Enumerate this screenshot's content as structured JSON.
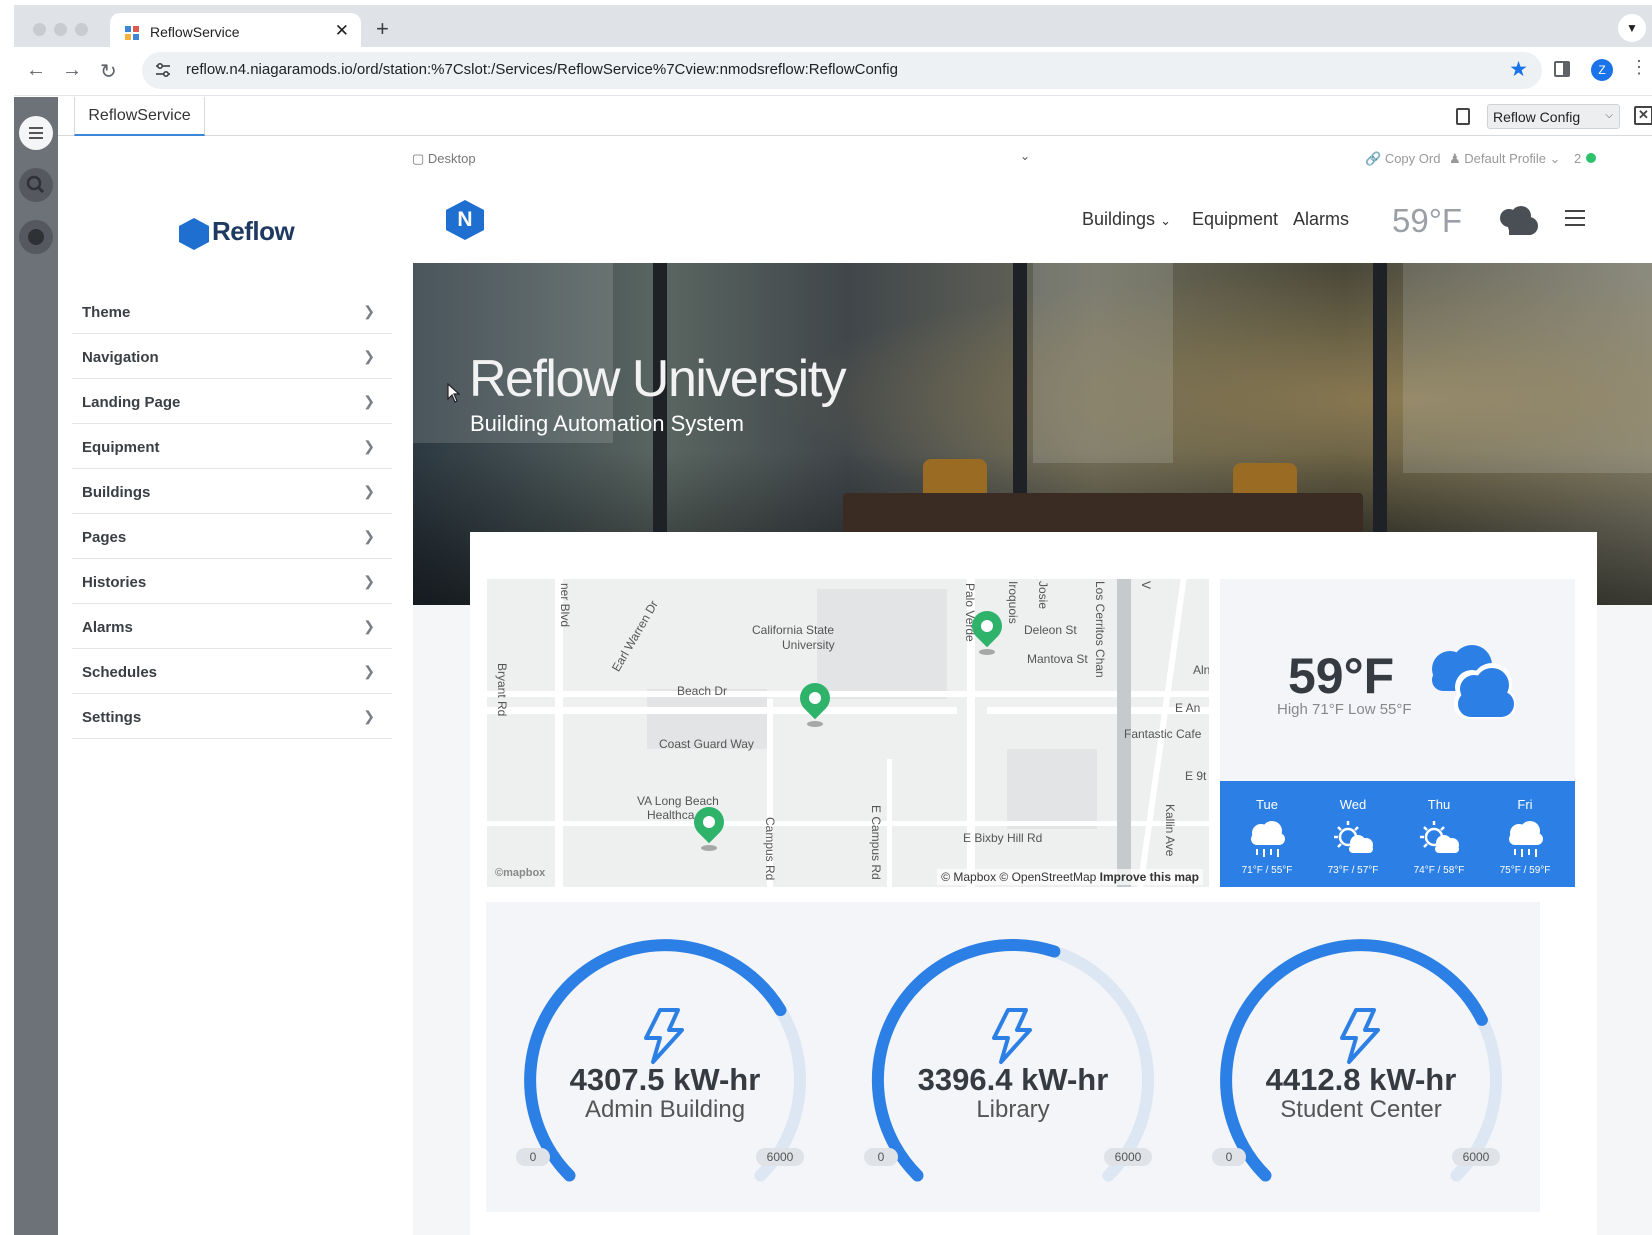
{
  "browser": {
    "tab_title": "ReflowService",
    "tab_close": "✕",
    "new_tab": "+",
    "url": "reflow.n4.niagaramods.io/ord/station:%7Cslot:/Services/ReflowService%7Cview:nmodsreflow:ReflowConfig",
    "avatar_letter": "Z"
  },
  "station": {
    "tab_label": "ReflowService",
    "view_selector": "Reflow Config"
  },
  "config_sidebar": {
    "logo_text": "Reflow",
    "items": [
      {
        "label": "Theme"
      },
      {
        "label": "Navigation"
      },
      {
        "label": "Landing Page"
      },
      {
        "label": "Equipment"
      },
      {
        "label": "Buildings"
      },
      {
        "label": "Pages"
      },
      {
        "label": "Histories"
      },
      {
        "label": "Alarms"
      },
      {
        "label": "Schedules"
      },
      {
        "label": "Settings"
      }
    ]
  },
  "profile_bar": {
    "device": "Desktop",
    "copy_ord": "Copy Ord",
    "profile": "Default Profile",
    "count": "2"
  },
  "app": {
    "logo_letter": "N",
    "nav": {
      "buildings": "Buildings",
      "equipment": "Equipment",
      "alarms": "Alarms",
      "temperature": "59°F"
    },
    "hero": {
      "title": "Reflow University",
      "subtitle": "Building Automation System"
    }
  },
  "map": {
    "labels": {
      "california_state": "California State",
      "university": "University",
      "beach_dr": "Beach Dr",
      "coast_guard_way": "Coast Guard Way",
      "va_long_beach": "VA Long Beach",
      "healthcare": "Healthca",
      "deleon_st": "Deleon St",
      "mantova_st": "Mantova St",
      "fantastic_cafe": "Fantastic Cafe",
      "e_bixby_hill_rd": "E Bixby Hill Rd",
      "earl_warren_dr": "Earl Warren Dr",
      "palo_verde": "Palo Verde",
      "iroquois": "Iroquois",
      "josie": "Josie",
      "los_cerritos_channel": "Los Cerritos Chan",
      "bryant_rd": "Bryant Rd",
      "ner_blvd": "ner Blvd",
      "campus_rd": "Campus Rd",
      "e_campus_rd": "E Campus Rd",
      "kallin_ave": "Kallin Ave",
      "e_an": "E An",
      "e_9t": "E 9t",
      "aln": "Aln",
      "v": "V"
    },
    "mapbox": "©mapbox",
    "attribution": "© Mapbox © OpenStreetMap",
    "improve": "Improve this map"
  },
  "weather": {
    "current_temp": "59°F",
    "high_low": "High 71°F Low 55°F",
    "forecast": [
      {
        "day": "Tue",
        "temps": "71°F / 55°F",
        "icon": "rain-cloud-icon"
      },
      {
        "day": "Wed",
        "temps": "73°F / 57°F",
        "icon": "partly-sunny-icon"
      },
      {
        "day": "Thu",
        "temps": "74°F / 58°F",
        "icon": "partly-sunny-icon"
      },
      {
        "day": "Fri",
        "temps": "75°F / 59°F",
        "icon": "rain-cloud-icon"
      }
    ]
  },
  "gauges": [
    {
      "value": 4307.5,
      "value_label": "4307.5 kW-hr",
      "name": "Admin Building",
      "min": "0",
      "max": "6000"
    },
    {
      "value": 3396.4,
      "value_label": "3396.4 kW-hr",
      "name": "Library",
      "min": "0",
      "max": "6000"
    },
    {
      "value": 4412.8,
      "value_label": "4412.8 kW-hr",
      "name": "Student Center",
      "min": "0",
      "max": "6000"
    }
  ],
  "colors": {
    "accent": "#2c7fe5",
    "gauge_track": "#dde6f3",
    "pin": "#2fb36a",
    "status_ok": "#2ec26a"
  }
}
